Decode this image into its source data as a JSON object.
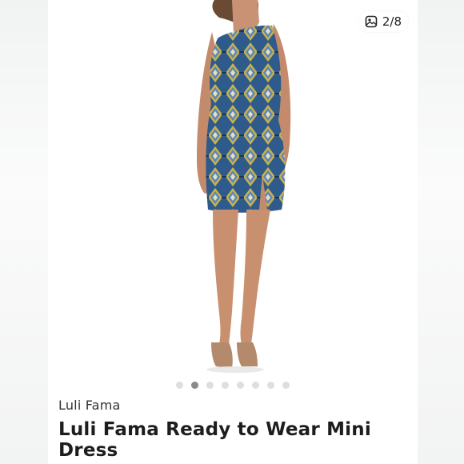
{
  "gallery": {
    "counter_text": "2/8",
    "image_alt": "Model wearing blue and yellow ikat print one-shoulder mini dress with front slit and nude platform heels",
    "dots_total": 8,
    "active_index": 1
  },
  "product": {
    "brand": "Luli Fama",
    "title": "Luli Fama Ready to Wear Mini Dress"
  },
  "colors": {
    "accent_dress_blue": "#2f5a8c",
    "accent_dress_yellow": "#c9b24a",
    "dot_active": "#8a8a8a",
    "dot_inactive": "#dedede"
  },
  "icons": {
    "counter": "image-gallery-icon"
  }
}
